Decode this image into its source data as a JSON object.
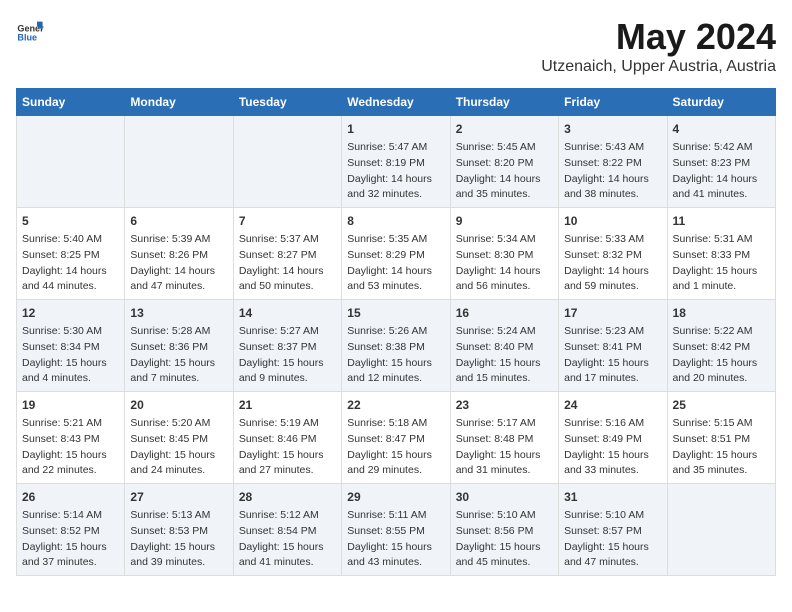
{
  "header": {
    "logo_general": "General",
    "logo_blue": "Blue",
    "title": "May 2024",
    "subtitle": "Utzenaich, Upper Austria, Austria"
  },
  "weekdays": [
    "Sunday",
    "Monday",
    "Tuesday",
    "Wednesday",
    "Thursday",
    "Friday",
    "Saturday"
  ],
  "weeks": [
    [
      {
        "day": "",
        "info": ""
      },
      {
        "day": "",
        "info": ""
      },
      {
        "day": "",
        "info": ""
      },
      {
        "day": "1",
        "info": "Sunrise: 5:47 AM\nSunset: 8:19 PM\nDaylight: 14 hours and 32 minutes."
      },
      {
        "day": "2",
        "info": "Sunrise: 5:45 AM\nSunset: 8:20 PM\nDaylight: 14 hours and 35 minutes."
      },
      {
        "day": "3",
        "info": "Sunrise: 5:43 AM\nSunset: 8:22 PM\nDaylight: 14 hours and 38 minutes."
      },
      {
        "day": "4",
        "info": "Sunrise: 5:42 AM\nSunset: 8:23 PM\nDaylight: 14 hours and 41 minutes."
      }
    ],
    [
      {
        "day": "5",
        "info": "Sunrise: 5:40 AM\nSunset: 8:25 PM\nDaylight: 14 hours and 44 minutes."
      },
      {
        "day": "6",
        "info": "Sunrise: 5:39 AM\nSunset: 8:26 PM\nDaylight: 14 hours and 47 minutes."
      },
      {
        "day": "7",
        "info": "Sunrise: 5:37 AM\nSunset: 8:27 PM\nDaylight: 14 hours and 50 minutes."
      },
      {
        "day": "8",
        "info": "Sunrise: 5:35 AM\nSunset: 8:29 PM\nDaylight: 14 hours and 53 minutes."
      },
      {
        "day": "9",
        "info": "Sunrise: 5:34 AM\nSunset: 8:30 PM\nDaylight: 14 hours and 56 minutes."
      },
      {
        "day": "10",
        "info": "Sunrise: 5:33 AM\nSunset: 8:32 PM\nDaylight: 14 hours and 59 minutes."
      },
      {
        "day": "11",
        "info": "Sunrise: 5:31 AM\nSunset: 8:33 PM\nDaylight: 15 hours and 1 minute."
      }
    ],
    [
      {
        "day": "12",
        "info": "Sunrise: 5:30 AM\nSunset: 8:34 PM\nDaylight: 15 hours and 4 minutes."
      },
      {
        "day": "13",
        "info": "Sunrise: 5:28 AM\nSunset: 8:36 PM\nDaylight: 15 hours and 7 minutes."
      },
      {
        "day": "14",
        "info": "Sunrise: 5:27 AM\nSunset: 8:37 PM\nDaylight: 15 hours and 9 minutes."
      },
      {
        "day": "15",
        "info": "Sunrise: 5:26 AM\nSunset: 8:38 PM\nDaylight: 15 hours and 12 minutes."
      },
      {
        "day": "16",
        "info": "Sunrise: 5:24 AM\nSunset: 8:40 PM\nDaylight: 15 hours and 15 minutes."
      },
      {
        "day": "17",
        "info": "Sunrise: 5:23 AM\nSunset: 8:41 PM\nDaylight: 15 hours and 17 minutes."
      },
      {
        "day": "18",
        "info": "Sunrise: 5:22 AM\nSunset: 8:42 PM\nDaylight: 15 hours and 20 minutes."
      }
    ],
    [
      {
        "day": "19",
        "info": "Sunrise: 5:21 AM\nSunset: 8:43 PM\nDaylight: 15 hours and 22 minutes."
      },
      {
        "day": "20",
        "info": "Sunrise: 5:20 AM\nSunset: 8:45 PM\nDaylight: 15 hours and 24 minutes."
      },
      {
        "day": "21",
        "info": "Sunrise: 5:19 AM\nSunset: 8:46 PM\nDaylight: 15 hours and 27 minutes."
      },
      {
        "day": "22",
        "info": "Sunrise: 5:18 AM\nSunset: 8:47 PM\nDaylight: 15 hours and 29 minutes."
      },
      {
        "day": "23",
        "info": "Sunrise: 5:17 AM\nSunset: 8:48 PM\nDaylight: 15 hours and 31 minutes."
      },
      {
        "day": "24",
        "info": "Sunrise: 5:16 AM\nSunset: 8:49 PM\nDaylight: 15 hours and 33 minutes."
      },
      {
        "day": "25",
        "info": "Sunrise: 5:15 AM\nSunset: 8:51 PM\nDaylight: 15 hours and 35 minutes."
      }
    ],
    [
      {
        "day": "26",
        "info": "Sunrise: 5:14 AM\nSunset: 8:52 PM\nDaylight: 15 hours and 37 minutes."
      },
      {
        "day": "27",
        "info": "Sunrise: 5:13 AM\nSunset: 8:53 PM\nDaylight: 15 hours and 39 minutes."
      },
      {
        "day": "28",
        "info": "Sunrise: 5:12 AM\nSunset: 8:54 PM\nDaylight: 15 hours and 41 minutes."
      },
      {
        "day": "29",
        "info": "Sunrise: 5:11 AM\nSunset: 8:55 PM\nDaylight: 15 hours and 43 minutes."
      },
      {
        "day": "30",
        "info": "Sunrise: 5:10 AM\nSunset: 8:56 PM\nDaylight: 15 hours and 45 minutes."
      },
      {
        "day": "31",
        "info": "Sunrise: 5:10 AM\nSunset: 8:57 PM\nDaylight: 15 hours and 47 minutes."
      },
      {
        "day": "",
        "info": ""
      }
    ]
  ]
}
